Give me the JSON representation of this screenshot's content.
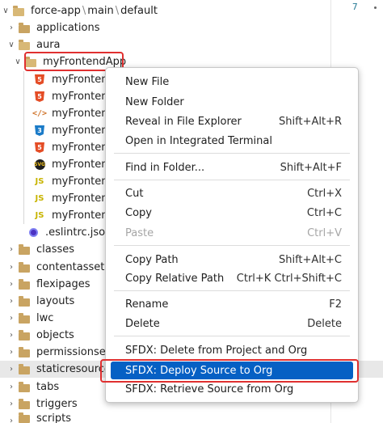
{
  "breadcrumb": [
    "force-app",
    "main",
    "default"
  ],
  "editor": {
    "line_number": "7"
  },
  "tree": {
    "items": [
      {
        "label": "applications",
        "icon": "folder-icon",
        "chevron": "right"
      },
      {
        "label": "aura",
        "icon": "folder-open-icon",
        "chevron": "down"
      },
      {
        "label": "myFrontendApp",
        "icon": "folder-open-icon",
        "chevron": "down"
      },
      {
        "label": "myFrontend",
        "icon": "html5-icon"
      },
      {
        "label": "myFrontend",
        "icon": "html5-icon"
      },
      {
        "label": "myFrontend",
        "icon": "xml-icon"
      },
      {
        "label": "myFrontend",
        "icon": "css3-icon"
      },
      {
        "label": "myFrontend",
        "icon": "html5-icon"
      },
      {
        "label": "myFrontend",
        "icon": "svg-icon"
      },
      {
        "label": "myFrontend",
        "icon": "js-icon"
      },
      {
        "label": "myFrontend",
        "icon": "js-icon"
      },
      {
        "label": "myFrontend",
        "icon": "js-icon"
      },
      {
        "label": ".eslintrc.json",
        "icon": "eslint-icon"
      },
      {
        "label": "classes",
        "icon": "folder-icon",
        "chevron": "right"
      },
      {
        "label": "contentassets",
        "icon": "folder-icon",
        "chevron": "right"
      },
      {
        "label": "flexipages",
        "icon": "folder-icon",
        "chevron": "right"
      },
      {
        "label": "layouts",
        "icon": "folder-icon",
        "chevron": "right"
      },
      {
        "label": "lwc",
        "icon": "folder-icon",
        "chevron": "right"
      },
      {
        "label": "objects",
        "icon": "folder-icon",
        "chevron": "right"
      },
      {
        "label": "permissionsets",
        "icon": "folder-icon",
        "chevron": "right"
      },
      {
        "label": "staticresources",
        "icon": "folder-icon",
        "chevron": "right"
      },
      {
        "label": "tabs",
        "icon": "folder-icon",
        "chevron": "right"
      },
      {
        "label": "triggers",
        "icon": "folder-icon",
        "chevron": "right"
      },
      {
        "label": "scripts",
        "icon": "folder-icon",
        "chevron": "right"
      }
    ]
  },
  "context_menu": {
    "new_file": "New File",
    "new_folder": "New Folder",
    "reveal": {
      "label": "Reveal in File Explorer",
      "shortcut": "Shift+Alt+R"
    },
    "open_terminal": "Open in Integrated Terminal",
    "find_in_folder": {
      "label": "Find in Folder...",
      "shortcut": "Shift+Alt+F"
    },
    "cut": {
      "label": "Cut",
      "shortcut": "Ctrl+X"
    },
    "copy": {
      "label": "Copy",
      "shortcut": "Ctrl+C"
    },
    "paste": {
      "label": "Paste",
      "shortcut": "Ctrl+V"
    },
    "copy_path": {
      "label": "Copy Path",
      "shortcut": "Shift+Alt+C"
    },
    "copy_relative_path": {
      "label": "Copy Relative Path",
      "shortcut": "Ctrl+K Ctrl+Shift+C"
    },
    "rename": {
      "label": "Rename",
      "shortcut": "F2"
    },
    "delete": {
      "label": "Delete",
      "shortcut": "Delete"
    },
    "sfdx_delete": "SFDX: Delete from Project and Org",
    "sfdx_deploy": "SFDX: Deploy Source to Org",
    "sfdx_retrieve": "SFDX: Retrieve Source from Org"
  },
  "colors": {
    "menu_highlight": "#0660c4",
    "annotation_outline": "#e03030",
    "folder": "#c9a462"
  }
}
